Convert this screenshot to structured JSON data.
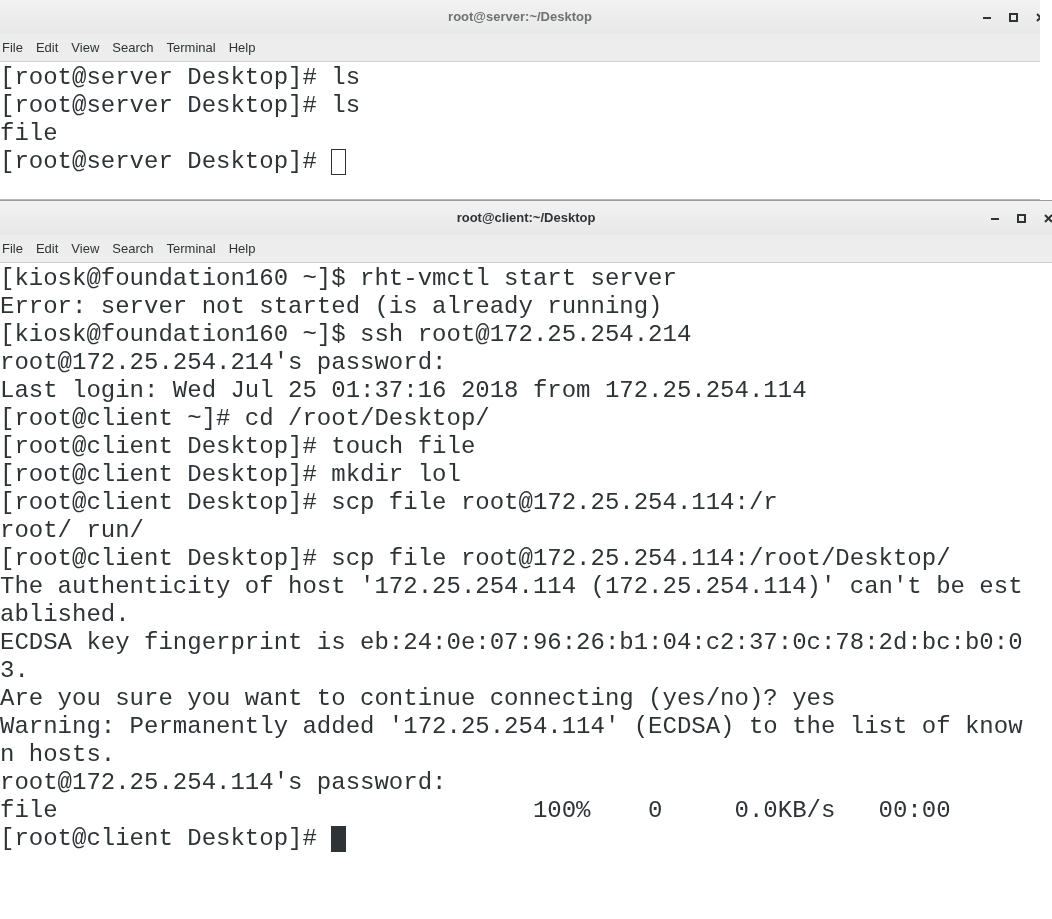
{
  "windows": [
    {
      "title": "root@server:~/Desktop",
      "focused": false,
      "menu": [
        "File",
        "Edit",
        "View",
        "Search",
        "Terminal",
        "Help"
      ],
      "lines": [
        "[root@server Desktop]# ls",
        "[root@server Desktop]# ls",
        "file",
        "[root@server Desktop]# "
      ]
    },
    {
      "title": "root@client:~/Desktop",
      "focused": true,
      "menu": [
        "File",
        "Edit",
        "View",
        "Search",
        "Terminal",
        "Help"
      ],
      "lines": [
        "[kiosk@foundation160 ~]$ rht-vmctl start server",
        "Error: server not started (is already running)",
        "[kiosk@foundation160 ~]$ ssh root@172.25.254.214",
        "root@172.25.254.214's password:",
        "Last login: Wed Jul 25 01:37:16 2018 from 172.25.254.114",
        "[root@client ~]# cd /root/Desktop/",
        "[root@client Desktop]# touch file",
        "[root@client Desktop]# mkdir lol",
        "[root@client Desktop]# scp file root@172.25.254.114:/r",
        "root/ run/",
        "[root@client Desktop]# scp file root@172.25.254.114:/root/Desktop/",
        "The authenticity of host '172.25.254.114 (172.25.254.114)' can't be est",
        "ablished.",
        "ECDSA key fingerprint is eb:24:0e:07:96:26:b1:04:c2:37:0c:78:2d:bc:b0:0",
        "3.",
        "Are you sure you want to continue connecting (yes/no)? yes",
        "Warning: Permanently added '172.25.254.114' (ECDSA) to the list of know",
        "n hosts.",
        "root@172.25.254.114's password:",
        "file                                 100%    0     0.0KB/s   00:00",
        "[root@client Desktop]# "
      ]
    }
  ]
}
